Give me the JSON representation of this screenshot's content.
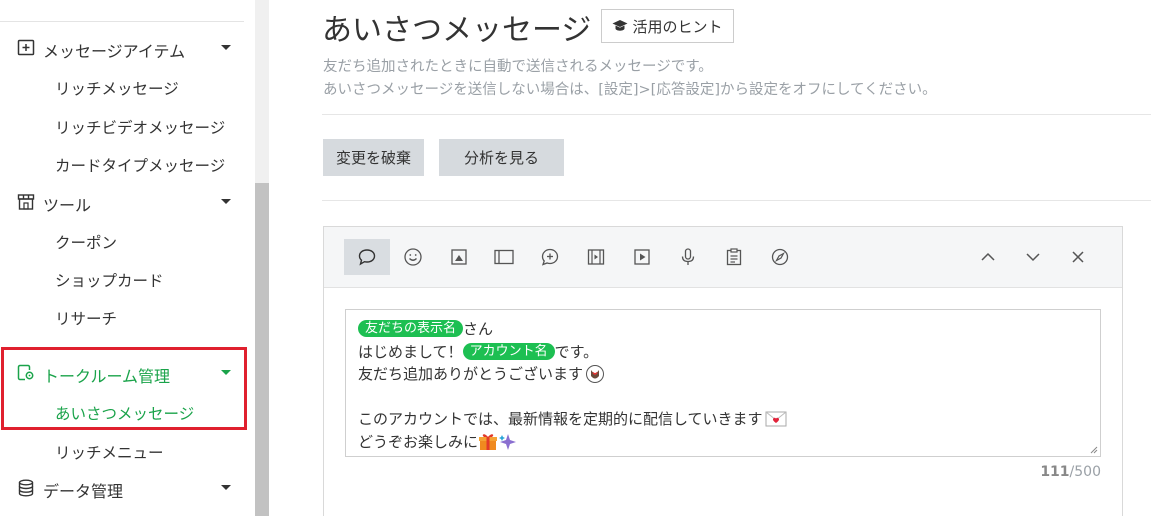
{
  "sidebar": {
    "sections": [
      {
        "label": "メッセージアイテム",
        "icon": "plus-square-icon"
      },
      {
        "label": "ツール",
        "icon": "store-icon"
      },
      {
        "label": "トークルーム管理",
        "icon": "chat-settings-icon"
      },
      {
        "label": "データ管理",
        "icon": "database-icon"
      }
    ],
    "message_items": [
      "リッチメッセージ",
      "リッチビデオメッセージ",
      "カードタイプメッセージ"
    ],
    "tools": [
      "クーポン",
      "ショップカード",
      "リサーチ"
    ],
    "talkroom": [
      "あいさつメッセージ",
      "リッチメニュー"
    ]
  },
  "page": {
    "title": "あいさつメッセージ",
    "hint_button": "活用のヒント",
    "desc1": "友だち追加されたときに自動で送信されるメッセージです。",
    "desc2": "あいさつメッセージを送信しない場合は、[設定]>[応答設定]から設定をオフにしてください。",
    "discard_button": "変更を破棄",
    "analytics_button": "分析を見る"
  },
  "editor": {
    "toolbar_icons": [
      "speech-bubble-icon",
      "smiley-icon",
      "image-icon",
      "card-icon",
      "coupon-icon",
      "video-icon",
      "play-icon",
      "microphone-icon",
      "survey-icon",
      "compass-icon"
    ],
    "tag_friend_name": "友だちの表示名",
    "tag_account_name": "アカウント名",
    "line1_suffix": "さん",
    "line2_prefix": "はじめまして！",
    "line2_suffix": "です。",
    "line3": "友だち追加ありがとうございます",
    "line5": "このアカウントでは、最新情報を定期的に配信していきます",
    "line6": "どうぞお楽しみに",
    "count_current": "111",
    "count_max": "/500"
  },
  "colors": {
    "accent": "#1aa34a",
    "highlight": "#e0202e",
    "tag": "#1dbf52"
  }
}
